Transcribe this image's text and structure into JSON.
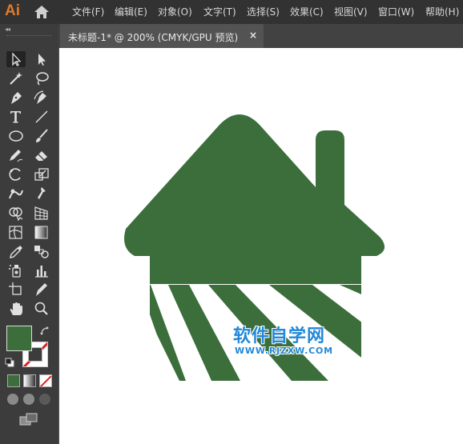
{
  "app": {
    "logo": "Ai"
  },
  "menu": {
    "items": [
      "文件(F)",
      "编辑(E)",
      "对象(O)",
      "文字(T)",
      "选择(S)",
      "效果(C)",
      "视图(V)",
      "窗口(W)",
      "帮助(H)"
    ]
  },
  "toolbar": {
    "collapse_label": "◂◂",
    "tools": [
      "selection-tool",
      "direct-selection-tool",
      "magic-wand-tool",
      "lasso-tool",
      "pen-tool",
      "curvature-tool",
      "type-tool",
      "line-segment-tool",
      "ellipse-tool",
      "paintbrush-tool",
      "pencil-tool",
      "eraser-tool",
      "rotate-tool",
      "scale-tool",
      "warp-tool",
      "puppet-warp-tool",
      "shape-builder-tool",
      "perspective-grid-tool",
      "mesh-tool",
      "gradient-tool",
      "eyedropper-tool",
      "blend-tool",
      "symbol-sprayer-tool",
      "column-graph-tool",
      "artboard-tool",
      "slice-tool",
      "hand-tool",
      "zoom-tool"
    ],
    "fill_color": "#3b6e3b",
    "stroke": "none"
  },
  "document": {
    "tab_label": "未标题-1* @ 200% (CMYK/GPU 预览)",
    "close_label": "×",
    "zoom": "200%",
    "color_mode": "CMYK/GPU 预览"
  },
  "artwork": {
    "color": "#3b6e3b",
    "subject": "house-with-field-icon"
  },
  "watermark": {
    "title": "软件自学网",
    "url": "WWW.RJZXW.COM",
    "color": "#2288d8"
  }
}
